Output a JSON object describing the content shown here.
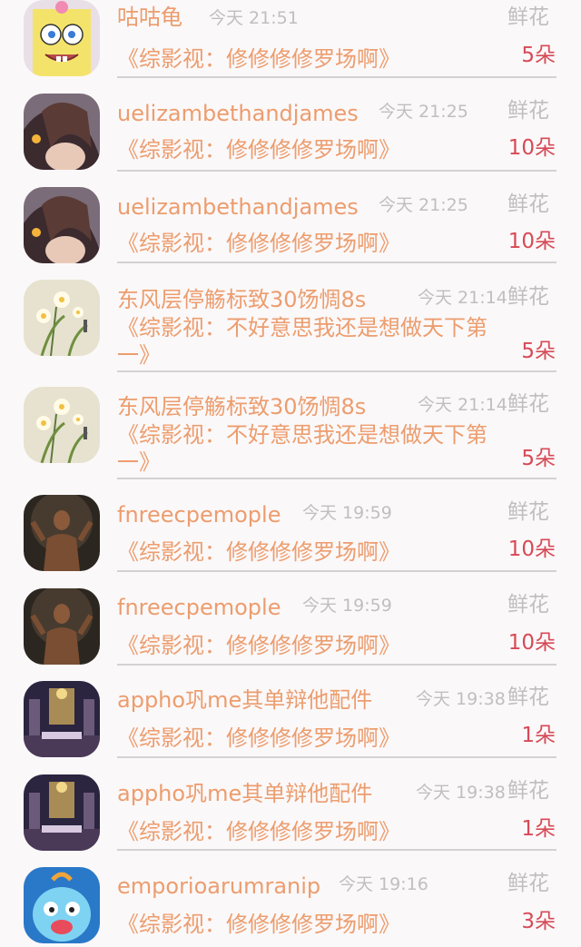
{
  "messages": [
    {
      "name": "咕咕龟",
      "time": "今天 21:51",
      "gift_label": "鲜花",
      "title": "《综影视：修修修修罗场啊》",
      "count": "5朵",
      "avatar_icon": "cartoon-sponge-avatar"
    },
    {
      "name": "uelizambethandjames",
      "time": "今天 21:25",
      "gift_label": "鲜花",
      "title": "《综影视：修修修修罗场啊》",
      "count": "10朵",
      "avatar_icon": "girl-hair-avatar"
    },
    {
      "name": "uelizambethandjames",
      "time": "今天 21:25",
      "gift_label": "鲜花",
      "title": "《综影视：修修修修罗场啊》",
      "count": "10朵",
      "avatar_icon": "girl-hair-avatar"
    },
    {
      "name": "东风层停觞标致30饧惆8s",
      "time": "今天 21:14",
      "gift_label": "鲜花",
      "title": "《综影视：不好意思我还是想做天下第一》",
      "count": "5朵",
      "avatar_icon": "flower-painting-avatar"
    },
    {
      "name": "东风层停觞标致30饧惆8s",
      "time": "今天 21:14",
      "gift_label": "鲜花",
      "title": "《综影视：不好意思我还是想做天下第一》",
      "count": "5朵",
      "avatar_icon": "flower-painting-avatar"
    },
    {
      "name": "fnreecpemople",
      "time": "今天 19:59",
      "gift_label": "鲜花",
      "title": "《综影视：修修修修罗场啊》",
      "count": "10朵",
      "avatar_icon": "man-portrait-avatar"
    },
    {
      "name": "fnreecpemople",
      "time": "今天 19:59",
      "gift_label": "鲜花",
      "title": "《综影视：修修修修罗场啊》",
      "count": "10朵",
      "avatar_icon": "man-portrait-avatar"
    },
    {
      "name": "appho巩me其单辩他配件",
      "time": "今天 19:38",
      "gift_label": "鲜花",
      "title": "《综影视：修修修修罗场啊》",
      "count": "1朵",
      "avatar_icon": "hall-interior-avatar"
    },
    {
      "name": "appho巩me其单辩他配件",
      "time": "今天 19:38",
      "gift_label": "鲜花",
      "title": "《综影视：修修修修罗场啊》",
      "count": "1朵",
      "avatar_icon": "hall-interior-avatar"
    },
    {
      "name": "emporioarumranip",
      "time": "今天 19:16",
      "gift_label": "鲜花",
      "title": "《综影视：修修修修罗场啊》",
      "count": "3朵",
      "avatar_icon": "cartoon-blue-creature-avatar"
    }
  ]
}
